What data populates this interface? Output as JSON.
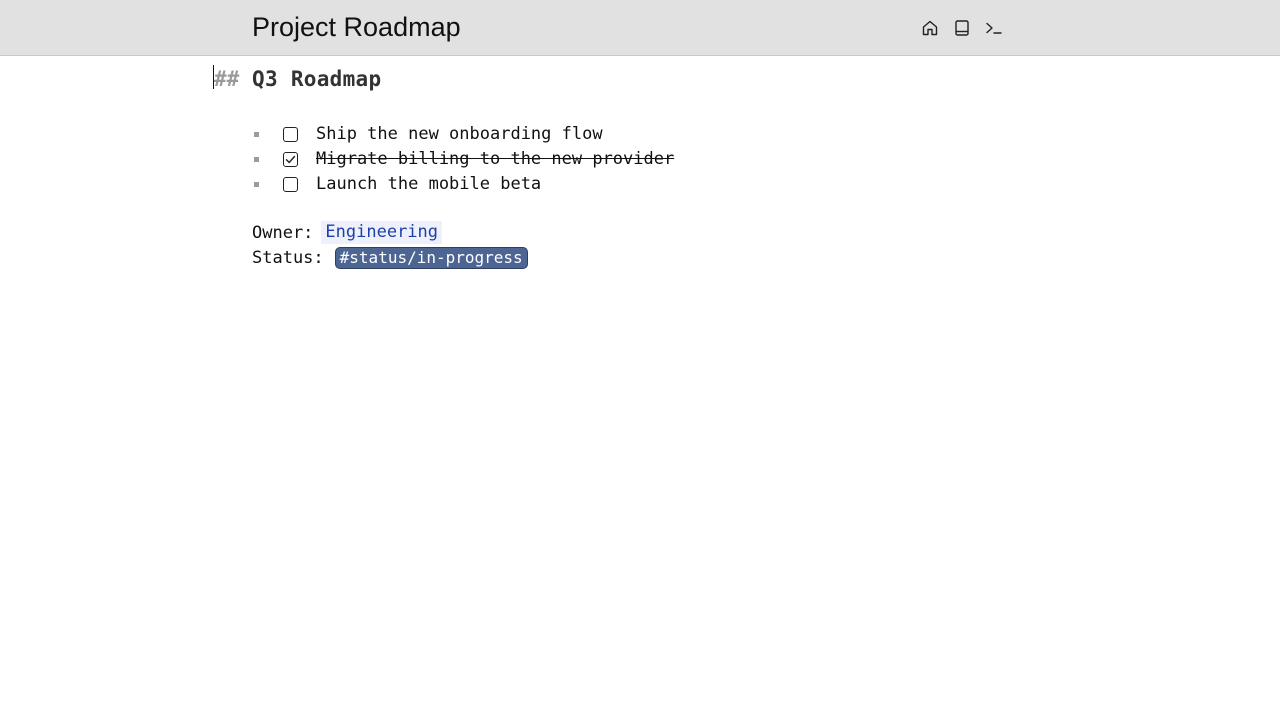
{
  "header": {
    "title": "Project Roadmap",
    "toolbar": [
      {
        "icon": "home-icon"
      },
      {
        "icon": "book-icon"
      },
      {
        "icon": "terminal-icon"
      }
    ]
  },
  "document": {
    "heading_marker": "##",
    "heading": "Q3 Roadmap",
    "tasks": [
      {
        "label": "Ship the new onboarding flow",
        "checked": false
      },
      {
        "label": "Migrate billing to the new provider",
        "checked": true
      },
      {
        "label": "Launch the mobile beta",
        "checked": false
      }
    ],
    "owner": {
      "label": "Owner:",
      "value": "Engineering"
    },
    "status": {
      "label": "Status:",
      "value": "#status/in-progress"
    }
  },
  "colors": {
    "topbar_bg": "#e1e1e1",
    "link": "#1d3fa8",
    "tag_bg": "#4c6592",
    "marker": "#9a9a9a"
  }
}
